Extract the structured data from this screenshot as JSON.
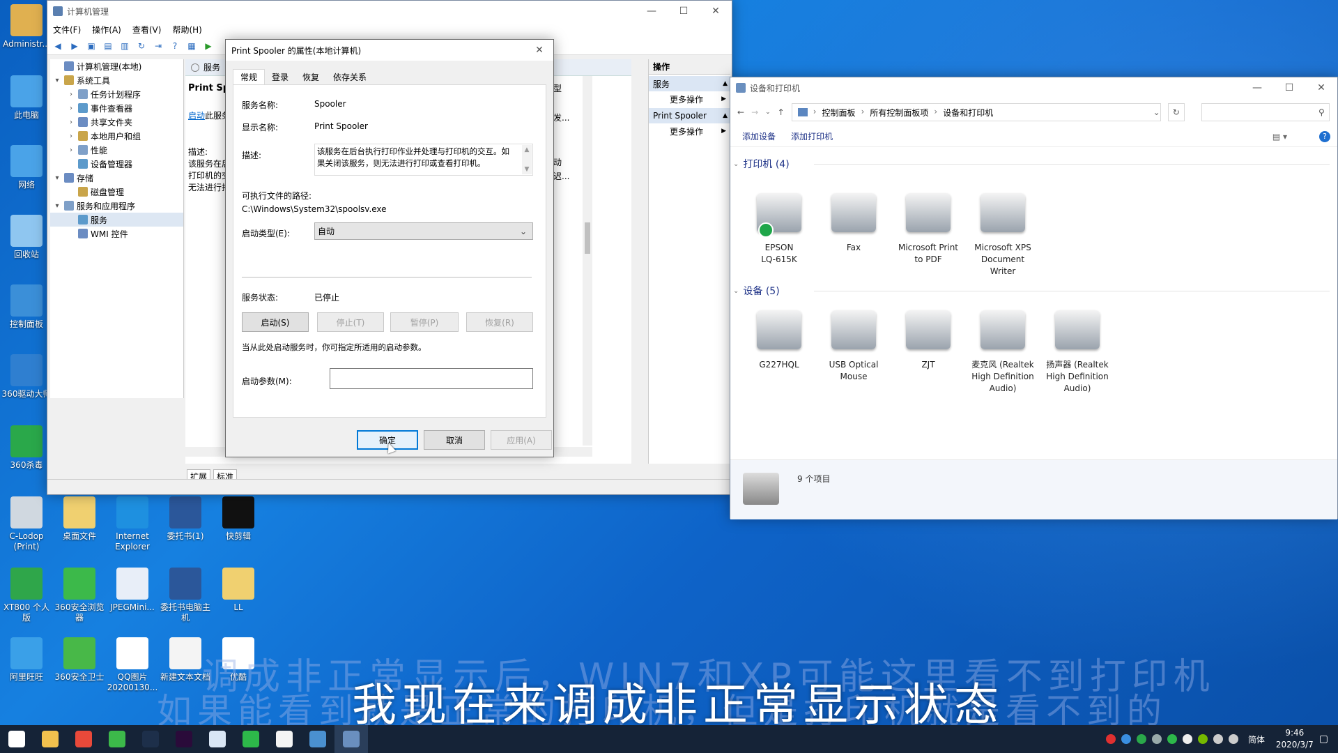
{
  "desktop": {
    "icons": [
      {
        "label": "Administr...",
        "icon": "user-folder-icon",
        "color": "#e0b050"
      },
      {
        "label": "此电脑",
        "icon": "computer-icon",
        "color": "#4aa3e8"
      },
      {
        "label": "网络",
        "icon": "network-icon",
        "color": "#4aa3e8"
      },
      {
        "label": "回收站",
        "icon": "recycle-bin-icon",
        "color": "#8fc6f0"
      },
      {
        "label": "控制面板",
        "icon": "control-panel-icon",
        "color": "#3b8fd8"
      },
      {
        "label": "360驱动大师",
        "icon": "gear-app-icon",
        "color": "#2f7fd0"
      },
      {
        "label": "360杀毒",
        "icon": "shield-app-icon",
        "color": "#2aa84a"
      },
      {
        "label": "C-Lodop (Print)",
        "icon": "printer-icon",
        "color": "#d0d8e0"
      },
      {
        "label": "桌面文件",
        "icon": "folder-icon",
        "color": "#f0d070"
      },
      {
        "label": "Internet Explorer",
        "icon": "ie-icon",
        "color": "#1e90e0"
      },
      {
        "label": "委托书(1)",
        "icon": "word-doc-icon",
        "color": "#2b579a"
      },
      {
        "label": "快剪辑",
        "icon": "video-app-icon",
        "color": "#111111"
      },
      {
        "label": "XT800 个人版",
        "icon": "remote-app-icon",
        "color": "#2fa64a"
      },
      {
        "label": "360安全浏览器",
        "icon": "browser-app-icon",
        "color": "#3cb94a"
      },
      {
        "label": "JPEGMini...",
        "icon": "image-app-icon",
        "color": "#e8eef8"
      },
      {
        "label": "委托书电脑主机",
        "icon": "word-doc-icon",
        "color": "#2b579a"
      },
      {
        "label": "LL",
        "icon": "folder-icon",
        "color": "#f0d070"
      },
      {
        "label": "阿里旺旺",
        "icon": "chat-app-icon",
        "color": "#3aa0e8"
      },
      {
        "label": "360安全卫士",
        "icon": "guard-app-icon",
        "color": "#48b848"
      },
      {
        "label": "QQ图片20200130...",
        "icon": "image-file-icon",
        "color": "#ffffff"
      },
      {
        "label": "新建文本文档",
        "icon": "text-file-icon",
        "color": "#f4f4f4"
      },
      {
        "label": "优酷",
        "icon": "youku-app-icon",
        "color": "#ffffff"
      }
    ]
  },
  "mmc": {
    "title": "计算机管理",
    "menu": [
      "文件(F)",
      "操作(A)",
      "查看(V)",
      "帮助(H)"
    ],
    "tree": [
      {
        "label": "计算机管理(本地)",
        "level": 0,
        "arrow": ""
      },
      {
        "label": "系统工具",
        "level": 0,
        "arrow": "▾"
      },
      {
        "label": "任务计划程序",
        "level": 1,
        "arrow": "›"
      },
      {
        "label": "事件查看器",
        "level": 1,
        "arrow": "›"
      },
      {
        "label": "共享文件夹",
        "level": 1,
        "arrow": "›"
      },
      {
        "label": "本地用户和组",
        "level": 1,
        "arrow": "›"
      },
      {
        "label": "性能",
        "level": 1,
        "arrow": "›"
      },
      {
        "label": "设备管理器",
        "level": 1,
        "arrow": ""
      },
      {
        "label": "存储",
        "level": 0,
        "arrow": "▾"
      },
      {
        "label": "磁盘管理",
        "level": 1,
        "arrow": ""
      },
      {
        "label": "服务和应用程序",
        "level": 0,
        "arrow": "▾"
      },
      {
        "label": "服务",
        "level": 1,
        "arrow": ""
      },
      {
        "label": "WMI 控件",
        "level": 1,
        "arrow": ""
      }
    ],
    "center_header": "服务",
    "center_service": "Print Spo",
    "center_link": "启动",
    "center_link_rest": "此服务",
    "center_desc_label": "描述:",
    "center_desc_lines": [
      "该服务在后",
      "打印机的交",
      "无法进行打"
    ],
    "bottom_tabs": [
      "扩展",
      "标准"
    ],
    "actions_title": "操作",
    "actions_sections": [
      {
        "header": "服务",
        "item": "更多操作"
      },
      {
        "header": "Print Spooler",
        "item": "更多操作"
      }
    ],
    "right_col_labels": [
      "型",
      "发...",
      "动",
      "迟..."
    ]
  },
  "dialog": {
    "title": "Print Spooler 的属性(本地计算机)",
    "tabs": [
      "常规",
      "登录",
      "恢复",
      "依存关系"
    ],
    "service_name_label": "服务名称:",
    "service_name": "Spooler",
    "display_name_label": "显示名称:",
    "display_name": "Print Spooler",
    "description_label": "描述:",
    "description": "该服务在后台执行打印作业并处理与打印机的交互。如果关闭该服务，则无法进行打印或查看打印机。",
    "path_label": "可执行文件的路径:",
    "path": "C:\\Windows\\System32\\spoolsv.exe",
    "startup_type_label": "启动类型(E):",
    "startup_type": "自动",
    "status_label": "服务状态:",
    "status": "已停止",
    "btn_start": "启动(S)",
    "btn_stop": "停止(T)",
    "btn_pause": "暂停(P)",
    "btn_resume": "恢复(R)",
    "hint": "当从此处启动服务时，你可指定所适用的启动参数。",
    "params_label": "启动参数(M):",
    "params_value": "",
    "btn_ok": "确定",
    "btn_cancel": "取消",
    "btn_apply": "应用(A)"
  },
  "devices": {
    "title": "设备和打印机",
    "breadcrumb": [
      "控制面板",
      "所有控制面板项",
      "设备和打印机"
    ],
    "toolbar": [
      "添加设备",
      "添加打印机"
    ],
    "printers_header": "打印机 (4)",
    "printers": [
      {
        "line1": "EPSON",
        "line2": "LQ-615K",
        "line3": "",
        "icon": "dot-matrix-printer-icon"
      },
      {
        "line1": "Fax",
        "line2": "",
        "line3": "",
        "icon": "fax-icon"
      },
      {
        "line1": "Microsoft Print",
        "line2": "to PDF",
        "line3": "",
        "icon": "printer-icon"
      },
      {
        "line1": "Microsoft XPS",
        "line2": "Document",
        "line3": "Writer",
        "icon": "printer-icon"
      }
    ],
    "devices_header": "设备 (5)",
    "devices": [
      {
        "line1": "G227HQL",
        "line2": "",
        "line3": "",
        "icon": "monitor-icon"
      },
      {
        "line1": "USB Optical",
        "line2": "Mouse",
        "line3": "",
        "icon": "mouse-icon"
      },
      {
        "line1": "ZJT",
        "line2": "",
        "line3": "",
        "icon": "computer-tower-icon"
      },
      {
        "line1": "麦克风 (Realtek",
        "line2": "High Definition",
        "line3": "Audio)",
        "icon": "microphone-icon"
      },
      {
        "line1": "扬声器 (Realtek",
        "line2": "High Definition",
        "line3": "Audio)",
        "icon": "speaker-icon"
      }
    ],
    "status": "9 个项目"
  },
  "subtitles": {
    "line_top": "调成非正常显示后，WIN7和XP可能这里看不到打印机",
    "line_back": "如果能看到就是正常的打印机，但是打印机就是看不到的",
    "line_main": "我现在来调成非正常显示状态"
  },
  "taskbar": {
    "apps": [
      "windows-start-icon",
      "file-explorer-icon",
      "chrome-icon",
      "360-browser-icon",
      "photoshop-icon",
      "premiere-icon",
      "feather-app-icon",
      "wechat-icon",
      "presentation-app-icon",
      "control-panel-icon",
      "computer-management-icon"
    ],
    "ime": "简体",
    "time": "9:46",
    "date": "2020/3/7"
  }
}
